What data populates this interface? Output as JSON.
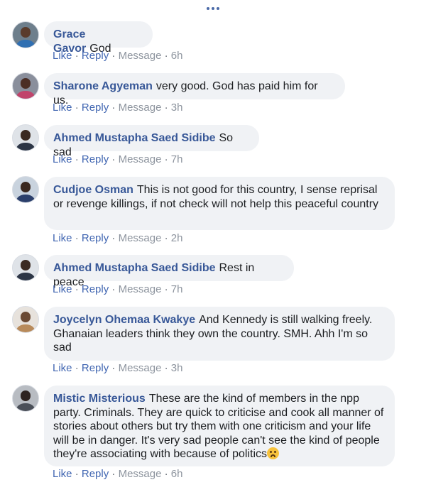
{
  "more_label": "more-options",
  "action_labels": {
    "like": "Like",
    "reply": "Reply",
    "message": "Message",
    "sep": "·"
  },
  "comments": [
    {
      "author": "Grace Gavor",
      "text": "God",
      "time": "6h"
    },
    {
      "author": "Sharone Agyeman",
      "text": "very good. God has paid him for us.",
      "time": "3h"
    },
    {
      "author": "Ahmed Mustapha Saed Sidibe",
      "text": "So sad",
      "time": "7h"
    },
    {
      "author": "Cudjoe Osman",
      "text": "This is not good for this country, I sense reprisal or revenge killings, if not check will not help this peaceful country",
      "time": "2h"
    },
    {
      "author": "Ahmed Mustapha Saed Sidibe",
      "text": "Rest in peace",
      "time": "7h"
    },
    {
      "author": "Joycelyn Ohemaa Kwakye",
      "text": "And Kennedy is still walking freely. Ghanaian leaders think they own the country. SMH. Ahh I'm so sad",
      "time": "3h"
    },
    {
      "author": "Mistic Misterious",
      "text": "These are the kind of members in the npp party. Criminals. They are quick to criticise and cook all manner of stories about others but try them with one criticism and your life will be in danger. It's very sad people can't see the kind of people they're associating with because of politics",
      "time": "6h",
      "emoji": "sad-face-emoji"
    }
  ]
}
